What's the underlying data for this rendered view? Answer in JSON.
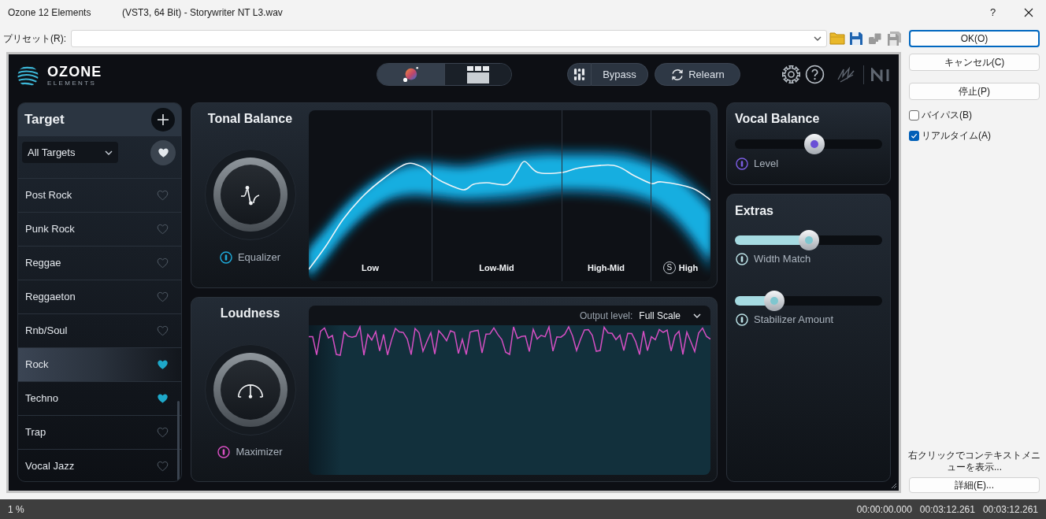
{
  "window": {
    "title": "Ozone 12 Elements",
    "subtitle": "(VST3, 64 Bit) - Storywriter NT L3.wav",
    "help": "?"
  },
  "preset": {
    "label": "プリセット(R):",
    "tools": [
      {
        "kind": "open",
        "disabled": false
      },
      {
        "kind": "save",
        "disabled": false
      },
      {
        "kind": "copy",
        "disabled": true
      },
      {
        "kind": "save_as",
        "disabled": true
      }
    ]
  },
  "plugin": {
    "logo": {
      "name": "OZONE",
      "edition": "ELEMENTS"
    },
    "view_tabs": [
      {
        "kind": "assistant",
        "selected": true
      },
      {
        "kind": "modules",
        "selected": false
      }
    ],
    "bypass": "Bypass",
    "relearn": "Relearn",
    "target": {
      "title": "Target",
      "filter": "All Targets",
      "items": [
        {
          "label": "Post Rock",
          "favorite": false,
          "selected": false
        },
        {
          "label": "Punk Rock",
          "favorite": false,
          "selected": false
        },
        {
          "label": "Reggae",
          "favorite": false,
          "selected": false
        },
        {
          "label": "Reggaeton",
          "favorite": false,
          "selected": false
        },
        {
          "label": "Rnb/Soul",
          "favorite": false,
          "selected": false
        },
        {
          "label": "Rock",
          "favorite": true,
          "selected": true
        },
        {
          "label": "Techno",
          "favorite": true,
          "selected": false
        },
        {
          "label": "Trap",
          "favorite": false,
          "selected": false
        },
        {
          "label": "Vocal Jazz",
          "favorite": false,
          "selected": false
        }
      ]
    },
    "tonal_balance": {
      "title": "Tonal Balance",
      "module": "Equalizer",
      "bands": [
        {
          "label": "Low"
        },
        {
          "label": "Low-Mid"
        },
        {
          "label": "High-Mid"
        },
        {
          "label": "High",
          "solo": "S"
        }
      ]
    },
    "loudness": {
      "title": "Loudness",
      "module": "Maximizer",
      "output_label": "Output level:",
      "output_value": "Full Scale"
    },
    "vocal_balance": {
      "title": "Vocal Balance",
      "sliders": [
        {
          "label": "Level",
          "level": 0.54
        }
      ]
    },
    "extras": {
      "title": "Extras",
      "sliders": [
        {
          "label": "Width Match",
          "level": 0.5
        },
        {
          "label": "Stabilizer Amount",
          "level": 0.27
        }
      ]
    }
  },
  "dialog_buttons": [
    {
      "label": "OK(O)",
      "focused": true
    },
    {
      "label": "キャンセル(C)",
      "focused": false
    },
    {
      "label": "停止(P)",
      "focused": false
    }
  ],
  "options": [
    {
      "label": "バイパス(B)",
      "checked": false
    },
    {
      "label": "リアルタイム(A)",
      "checked": true
    }
  ],
  "hint": "右クリックでコンテキストメニューを表示...",
  "details_button": "詳細(E)...",
  "status_bar": {
    "progress": "1 %",
    "times": [
      "00:00:00.000",
      "00:03:12.261",
      "00:03:12.261"
    ]
  }
}
